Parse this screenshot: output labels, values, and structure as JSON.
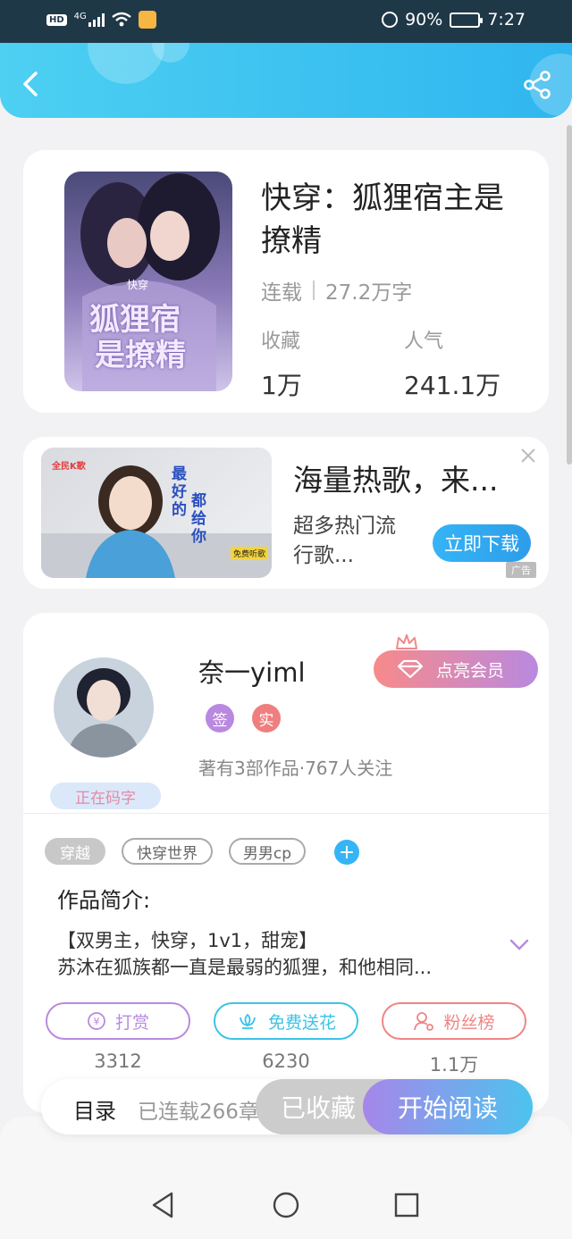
{
  "status_bar": {
    "network": "4G",
    "battery": "90%",
    "time": "7:27"
  },
  "book": {
    "title": "快穿：狐狸宿主是撩精",
    "status": "连载",
    "word_count": "27.2万字",
    "favorites_label": "收藏",
    "favorites_value": "1万",
    "popularity_label": "人气",
    "popularity_value": "241.1万",
    "cover_title_line1": "狐狸宿",
    "cover_title_line2": "是撩精",
    "cover_series": "快穿"
  },
  "ad": {
    "brand": "全民K歌",
    "image_text1": "最好的",
    "image_text2": "都给你",
    "image_tag": "免费听歌",
    "title": "海量热歌，来...",
    "description": "超多热门流行歌...",
    "button": "立即下载",
    "ad_label": "广告"
  },
  "author": {
    "name": "奈一yiml",
    "badge1": "签",
    "badge2": "实",
    "meta": "著有3部作品·767人关注",
    "writing_status": "正在码字",
    "vip_button": "点亮会员"
  },
  "tags": [
    "穿越",
    "快穿世界",
    "男男cp"
  ],
  "intro": {
    "heading": "作品简介:",
    "line1": "【双男主，快穿，1v1，甜宠】",
    "line2": "苏沐在狐族都一直是最弱的狐狸，和他相同..."
  },
  "actions": [
    {
      "label": "打赏",
      "count": "3312"
    },
    {
      "label": "免费送花",
      "count": "6230"
    },
    {
      "label": "粉丝榜",
      "count": "1.1万"
    }
  ],
  "bottom_bar": {
    "toc_label": "目录",
    "toc_count": "已连载266章",
    "collected": "已收藏",
    "read": "开始阅读"
  },
  "colors": {
    "header_start": "#4dd0f2",
    "header_end": "#2fb6ef",
    "reward": "#b98ae0",
    "flower": "#3cc3e6",
    "fans": "#ef8585"
  }
}
